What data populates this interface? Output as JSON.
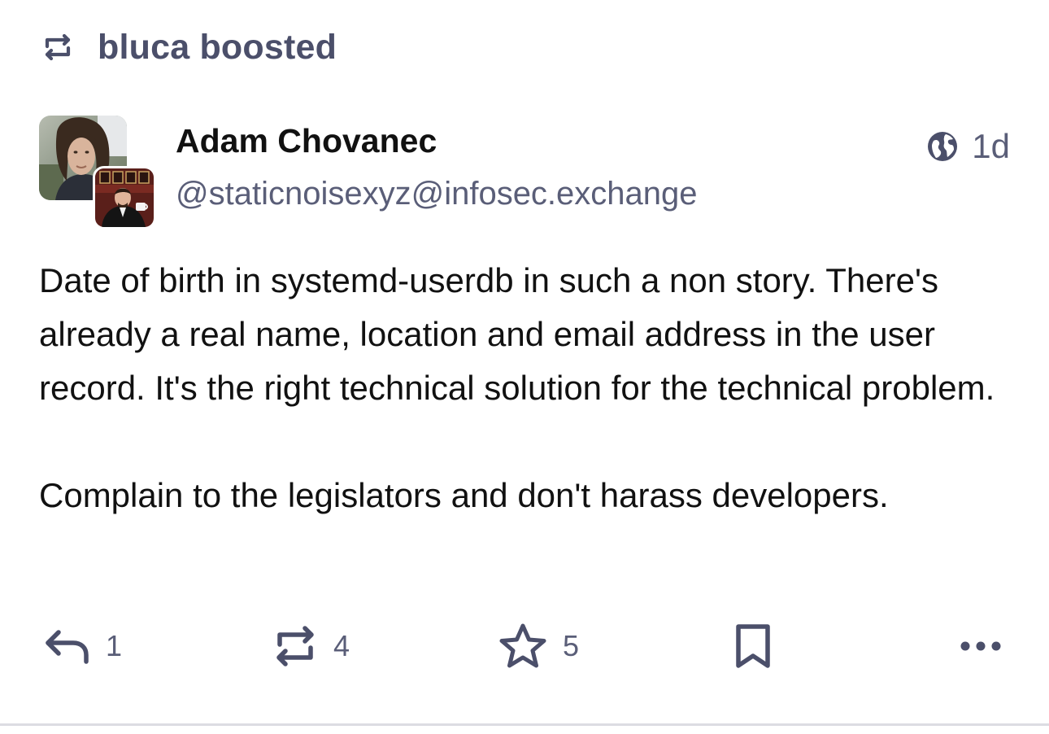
{
  "boost": {
    "text": "bluca boosted",
    "icon": "boost-icon"
  },
  "author": {
    "display_name": "Adam Chovanec",
    "handle": "@staticnoisexyz@infosec.exchange"
  },
  "meta": {
    "visibility_icon": "globe-icon",
    "time": "1d"
  },
  "content": {
    "paragraphs": [
      "Date of birth in systemd-userdb in such a non story. There's already a real name, location and email address in the user record. It's the right technical solution for the technical problem.",
      "Complain to the legislators and don't harass developers."
    ]
  },
  "actions": {
    "reply": {
      "icon": "reply-icon",
      "count": "1"
    },
    "boost": {
      "icon": "boost-icon",
      "count": "4"
    },
    "favourite": {
      "icon": "star-icon",
      "count": "5"
    },
    "bookmark": {
      "icon": "bookmark-icon"
    },
    "more": {
      "icon": "more-icon"
    }
  },
  "colors": {
    "accent": "#4b4f6a",
    "secondary_text": "#5a5e78",
    "primary_text": "#111111",
    "divider": "#dcdce2"
  }
}
